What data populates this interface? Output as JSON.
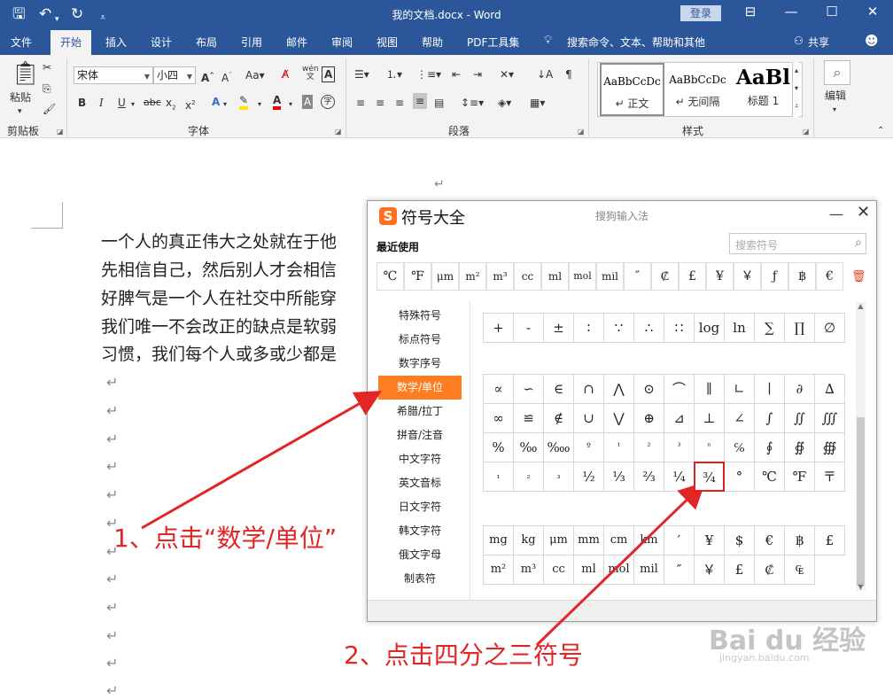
{
  "titlebar": {
    "doc_title": "我的文档.docx  -  Word",
    "login": "登录",
    "icons": [
      "save-icon",
      "undo-icon",
      "redo-icon",
      "customize-icon"
    ]
  },
  "tabs": [
    {
      "label": "文件"
    },
    {
      "label": "开始",
      "active": true
    },
    {
      "label": "插入"
    },
    {
      "label": "设计"
    },
    {
      "label": "布局"
    },
    {
      "label": "引用"
    },
    {
      "label": "邮件"
    },
    {
      "label": "审阅"
    },
    {
      "label": "视图"
    },
    {
      "label": "帮助"
    },
    {
      "label": "PDF工具集"
    }
  ],
  "tell_me": "搜索命令、文本、帮助和其他",
  "share": "共享",
  "ribbon": {
    "paste": "粘贴",
    "font_name": "宋体",
    "font_size": "小四",
    "style_a_big": "A",
    "style_aa": "Aa",
    "wen": "wén",
    "groups": {
      "clipboard": "剪贴板",
      "font": "字体",
      "paragraph": "段落",
      "styles": "样式"
    },
    "styles": [
      {
        "preview": "AaBbCcDc",
        "name": "↵ 正文"
      },
      {
        "preview": "AaBbCcDc",
        "name": "↵ 无间隔"
      },
      {
        "preview": "AaBl",
        "name": "标题 1"
      }
    ],
    "edit": "编辑"
  },
  "document": {
    "lines": [
      "一个人的真正伟大之处就在于他",
      "先相信自己，然后别人才会相信",
      "好脾气是一个人在社交中所能穿",
      "我们唯一不会改正的缺点是软弱",
      "习惯，我们每个人或多或少都是"
    ],
    "pilcrow": "↵"
  },
  "dialog": {
    "title": "符号大全",
    "subtitle": "搜狗输入法",
    "logo": "S",
    "recent_label": "最近使用",
    "search_placeholder": "搜索符号",
    "recent": [
      "℃",
      "℉",
      "μm",
      "m²",
      "m³",
      "cc",
      "ml",
      "mol",
      "mil",
      "″",
      "₡",
      "£",
      "¥",
      "￥",
      "ƒ",
      "฿",
      "€"
    ],
    "categories": [
      "特殊符号",
      "标点符号",
      "数字序号",
      "数学/单位",
      "希腊/拉丁",
      "拼音/注音",
      "中文字符",
      "英文音标",
      "日文字符",
      "韩文字符",
      "俄文字母",
      "制表符"
    ],
    "active_category": "数学/单位",
    "grid1": [
      "+",
      "-",
      "±",
      "∶",
      "∵",
      "∴",
      "∷",
      "log",
      "ln",
      "∑",
      "∏",
      "∅"
    ],
    "grid2": [
      [
        "∝",
        "∽",
        "∈",
        "∩",
        "⋀",
        "⊙",
        "⌒",
        "∥",
        "∟",
        "∣",
        "∂",
        "∆"
      ],
      [
        "∞",
        "≌",
        "∉",
        "∪",
        "⋁",
        "⊕",
        "⊿",
        "⊥",
        "∠",
        "∫",
        "∬",
        "∭"
      ],
      [
        "%",
        "‰",
        "‱",
        "º",
        "¹",
        "²",
        "³",
        "ⁿ",
        "℅",
        "∮",
        "∯",
        "∰"
      ],
      [
        "₁",
        "₂",
        "₃",
        "½",
        "⅓",
        "⅔",
        "¼",
        "¾",
        "°",
        "℃",
        "℉",
        "〒"
      ]
    ],
    "grid3": [
      [
        "mg",
        "kg",
        "μm",
        "mm",
        "cm",
        "km",
        "′",
        "¥",
        "$",
        "€",
        "฿",
        "£"
      ],
      [
        "m²",
        "m³",
        "cc",
        "ml",
        "mol",
        "mil",
        "″",
        "￥",
        "£",
        "₡",
        "₠"
      ]
    ],
    "highlighted": "¾"
  },
  "annotations": {
    "step1": "1、点击“数学/单位”",
    "step2": "2、点击四分之三符号"
  },
  "watermark": {
    "logo": "Bai du 经验",
    "url": "jingyan.baidu.com"
  },
  "colors": {
    "accent": "#2b579a",
    "sogou": "#ff7d22",
    "annotation": "#e22626"
  }
}
